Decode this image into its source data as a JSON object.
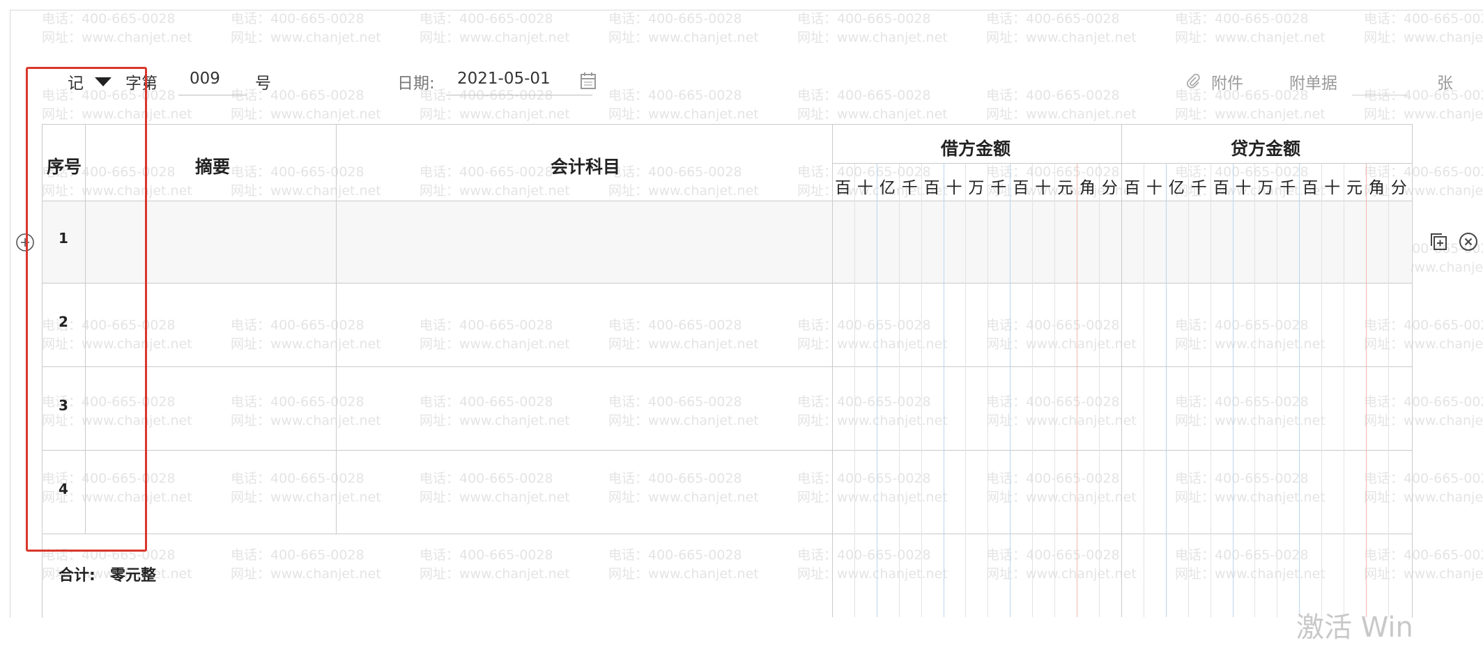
{
  "watermark": {
    "phone": "电话：400-665-0028",
    "website": "网址：www.chanjet.net"
  },
  "voucher_header": {
    "type_value": "记",
    "type_suffix": "字第",
    "number": "009",
    "number_suffix": "号",
    "date_label": "日期:",
    "date_value": "2021-05-01",
    "attachment_label": "附件",
    "attached_docs_label": "附单据",
    "sheets_suffix": "张"
  },
  "table": {
    "headers": {
      "index": "序号",
      "summary": "摘要",
      "account": "会计科目",
      "debit": "借方金额",
      "credit": "贷方金额"
    },
    "amount_digits": [
      "百",
      "十",
      "亿",
      "千",
      "百",
      "十",
      "万",
      "千",
      "百",
      "十",
      "元",
      "角",
      "分"
    ],
    "rows": [
      {
        "index": "1"
      },
      {
        "index": "2"
      },
      {
        "index": "3"
      },
      {
        "index": "4"
      }
    ],
    "total": {
      "label": "合计:",
      "value": "零元整"
    }
  },
  "overlay_text": "激活 Win",
  "colors": {
    "highlight_border": "#d9362c",
    "row_selected_bg": "#f7f7f8",
    "digit_sep_blue": "#b9d6ef",
    "digit_sep_red": "#efb8a8",
    "grid": "#c9c9c9"
  },
  "icons": {
    "add_row": "plus-circle-icon",
    "copy_row": "copy-add-icon",
    "delete_row": "close-circle-icon",
    "calendar": "calendar-icon",
    "attachment": "paperclip-icon",
    "dropdown": "triangle-down-icon"
  }
}
